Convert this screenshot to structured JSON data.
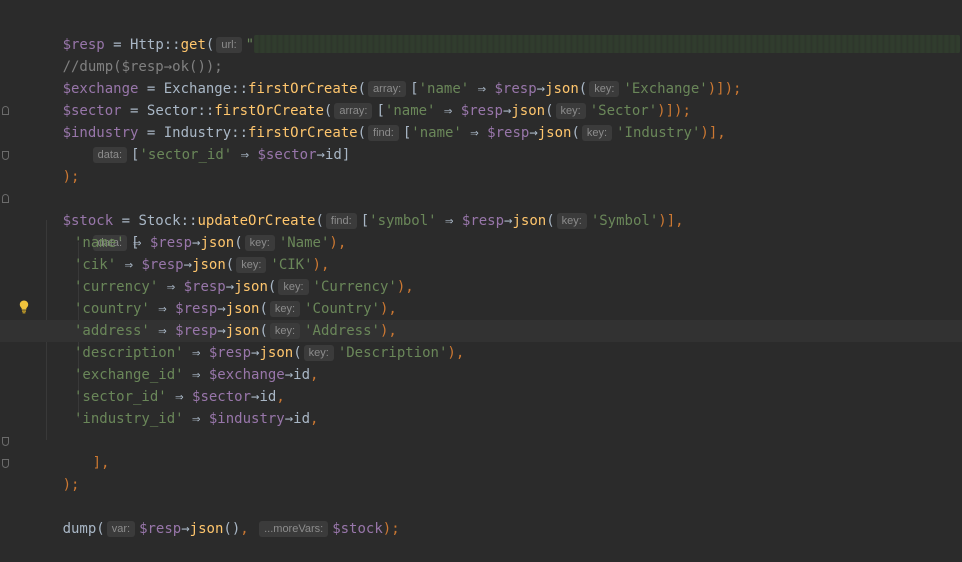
{
  "editor": {
    "lines": {
      "l1": {
        "resp_var": "$resp",
        "assign": " = ",
        "http_cls": "Http",
        "scope": "::",
        "get_fn": "get",
        "open": "(",
        "hint_url": "url:",
        "quote": "\"",
        "close": ");"
      },
      "l2": {
        "comment": "//dump($resp→ok());"
      },
      "l3": {
        "var": "$exchange",
        "assign": " = ",
        "cls": "Exchange",
        "scope": "::",
        "fn": "firstOrCreate",
        "open": "(",
        "hint": "array:",
        "bracket_open": "[",
        "key_str": "'name'",
        "arrow": " ⇒ ",
        "resp": "$resp",
        "obj_arrow": "→",
        "json_fn": "json",
        "open2": "(",
        "hint_key": "key:",
        "val_str": "'Exchange'",
        "close": ")]);"
      },
      "l4": {
        "var": "$sector",
        "assign": " = ",
        "cls": "Sector",
        "scope": "::",
        "fn": "firstOrCreate",
        "open": "(",
        "hint": "array:",
        "bracket_open": "[",
        "key_str": "'name'",
        "arrow": " ⇒ ",
        "resp": "$resp",
        "obj_arrow": "→",
        "json_fn": "json",
        "open2": "(",
        "hint_key": "key:",
        "val_str": "'Sector'",
        "close": ")]);"
      },
      "l5": {
        "var": "$industry",
        "assign": " = ",
        "cls": "Industry",
        "scope": "::",
        "fn": "firstOrCreate",
        "open": "(",
        "hint": "find:",
        "bracket_open": "[",
        "key_str": "'name'",
        "arrow": " ⇒ ",
        "resp": "$resp",
        "obj_arrow": "→",
        "json_fn": "json",
        "open2": "(",
        "hint_key": "key:",
        "val_str": "'Industry'",
        "close": ")],"
      },
      "l6": {
        "hint": "data:",
        "bracket_open": "[",
        "key_str": "'sector_id'",
        "arrow": " ⇒ ",
        "var": "$sector",
        "obj_arrow": "→",
        "prop": "id",
        "close": "]"
      },
      "l7": {
        "close": ");"
      },
      "l9": {
        "var": "$stock",
        "assign": " = ",
        "cls": "Stock",
        "scope": "::",
        "fn": "updateOrCreate",
        "open": "(",
        "hint": "find:",
        "bracket_open": "[",
        "key_str": "'symbol'",
        "arrow": " ⇒ ",
        "resp": "$resp",
        "obj_arrow": "→",
        "json_fn": "json",
        "open2": "(",
        "hint_key": "key:",
        "val_str": "'Symbol'",
        "close": ")],"
      },
      "l10": {
        "hint": "data:",
        "bracket_open": "["
      },
      "l21": {
        "close": "],"
      },
      "l22": {
        "close": ");"
      },
      "l24": {
        "fn": "dump",
        "open": "(",
        "hint_var": "var:",
        "resp": "$resp",
        "obj_arrow": "→",
        "json_fn": "json",
        "call": "()",
        "comma": ", ",
        "hint_more": "...moreVars:",
        "stock": "$stock",
        "close": ");"
      }
    },
    "data_entries": [
      {
        "key": "'name'",
        "kind": "json",
        "hint": "key:",
        "value": "'Name'"
      },
      {
        "key": "'cik'",
        "kind": "json",
        "hint": "key:",
        "value": "'CIK'"
      },
      {
        "key": "'currency'",
        "kind": "json",
        "hint": "key:",
        "value": "'Currency'"
      },
      {
        "key": "'country'",
        "kind": "json",
        "hint": "key:",
        "value": "'Country'"
      },
      {
        "key": "'address'",
        "kind": "json",
        "hint": "key:",
        "value": "'Address'"
      },
      {
        "key": "'description'",
        "kind": "json",
        "hint": "key:",
        "value": "'Description'"
      },
      {
        "key": "'exchange_id'",
        "kind": "prop",
        "var": "$exchange",
        "prop": "id"
      },
      {
        "key": "'sector_id'",
        "kind": "prop",
        "var": "$sector",
        "prop": "id"
      },
      {
        "key": "'industry_id'",
        "kind": "prop",
        "var": "$industry",
        "prop": "id"
      }
    ],
    "common": {
      "arrow": " ⇒ ",
      "resp": "$resp",
      "obj_arrow": "→",
      "json_fn": "json",
      "open": "(",
      "close_call": "),",
      "comma": ","
    },
    "current_line_index": 4,
    "icons": {
      "intention": "lightbulb-icon",
      "fold": "fold-marker-icon"
    },
    "colors": {
      "background": "#2b2b2b",
      "variable": "#9876aa",
      "function": "#ffc66d",
      "string": "#6a8759",
      "keyword": "#cc7832",
      "comment": "#808080",
      "text": "#a9b7c6",
      "bulb": "#f0c33c"
    }
  }
}
